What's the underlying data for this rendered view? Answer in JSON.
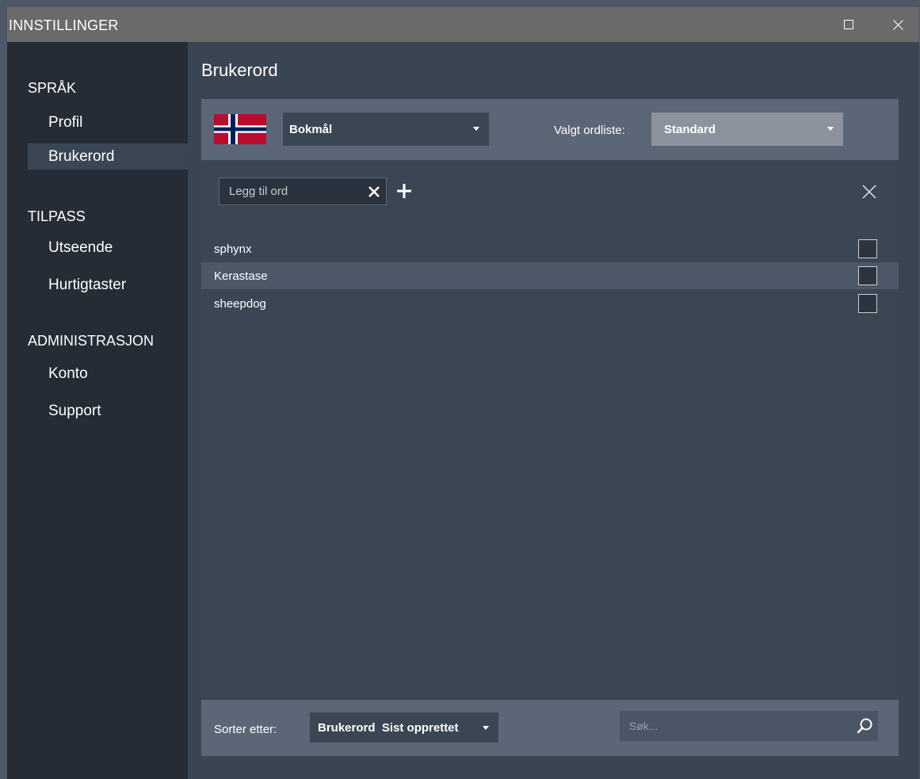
{
  "window": {
    "title": "INNSTILLINGER"
  },
  "sidebar": {
    "sections": [
      {
        "label": "SPRÅK",
        "items": [
          {
            "label": "Profil"
          },
          {
            "label": "Brukerord",
            "active": true
          }
        ]
      },
      {
        "label": "TILPASS",
        "items": [
          {
            "label": "Utseende"
          },
          {
            "label": "Hurtigtaster"
          }
        ]
      },
      {
        "label": "ADMINISTRASJON",
        "items": [
          {
            "label": "Konto"
          },
          {
            "label": "Support"
          }
        ]
      }
    ]
  },
  "main": {
    "title": "Brukerord",
    "language": {
      "flag_icon": "norway-flag-icon",
      "selected": "Bokmål"
    },
    "wordlist": {
      "label": "Valgt ordliste:",
      "selected": "Standard"
    },
    "add_word": {
      "placeholder": "Legg til ord",
      "value": ""
    },
    "words": [
      {
        "text": "sphynx",
        "checked": false,
        "highlighted": false
      },
      {
        "text": "Kerastase",
        "checked": false,
        "highlighted": true
      },
      {
        "text": "sheepdog",
        "checked": false,
        "highlighted": false
      }
    ],
    "footer": {
      "sort_label": "Sorter etter:",
      "sort_selected": "Brukerord  Sist opprettet",
      "search_placeholder": "Søk...",
      "search_value": ""
    }
  },
  "colors": {
    "titlebar": "#6a6a6a",
    "sidebar": "#252c36",
    "content": "#3a4554",
    "panel_bar": "#5b6677",
    "row_highlight": "#4c5767",
    "accent_select": "#8c939e",
    "flag_red": "#ba0c2f",
    "flag_blue": "#00205b"
  }
}
